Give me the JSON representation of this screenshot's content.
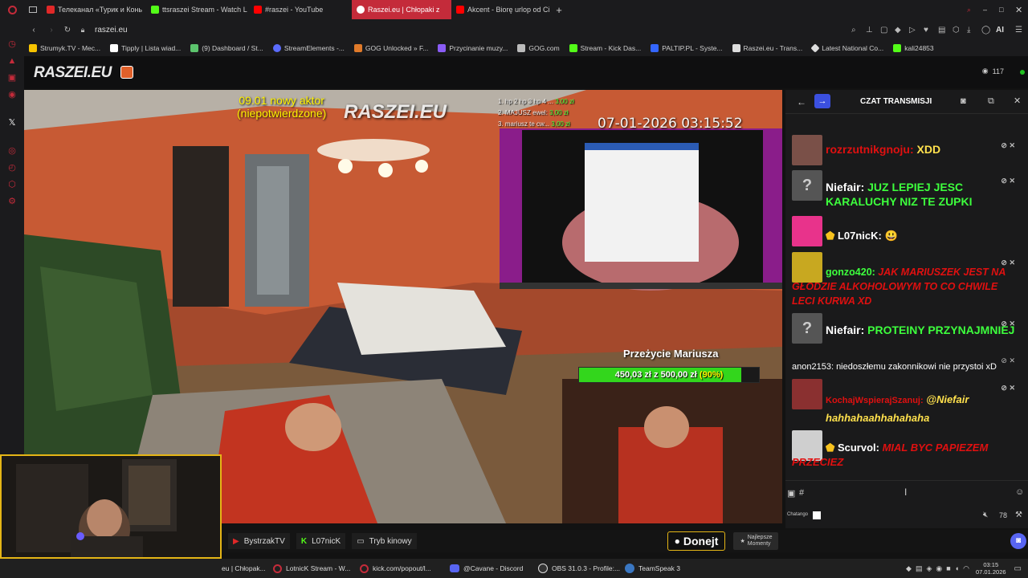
{
  "browser": {
    "tabs": [
      {
        "label": "Телеканал «Турик и Конь",
        "color": "#e02828"
      },
      {
        "label": "ttsraszei Stream - Watch L",
        "color": "#53fc18"
      },
      {
        "label": "#raszei - YouTube",
        "color": "#ff0000"
      },
      {
        "label": "Raszei.eu | Chłopaki z",
        "color": "#ffffff",
        "active": true
      },
      {
        "label": "Akcent - Biorę urlop od Ci",
        "color": "#ff0000"
      }
    ],
    "new_tab": "+",
    "url": "raszei.eu",
    "bookmarks": [
      {
        "label": "Strumyk.TV - Mec...",
        "color": "#f6c300"
      },
      {
        "label": "Tipply | Lista wiad...",
        "color": "#ffffff"
      },
      {
        "label": "(9) Dashboard / St...",
        "color": "#5cc46d"
      },
      {
        "label": "StreamElements -...",
        "color": "#5b6cff"
      },
      {
        "label": "GOG Unlocked » F...",
        "color": "#e07a2a"
      },
      {
        "label": "Przycinanie muzy...",
        "color": "#8a5cf6"
      },
      {
        "label": "GOG.com",
        "color": "#bbbbbb"
      },
      {
        "label": "Stream - Kick Das...",
        "color": "#53fc18"
      },
      {
        "label": "PALTIP.PL - Syste...",
        "color": "#3466ff"
      },
      {
        "label": "Raszei.eu - Trans...",
        "color": "#dddddd"
      },
      {
        "label": "Latest National Co...",
        "color": "#dddddd"
      },
      {
        "label": "kali24853",
        "color": "#53fc18"
      }
    ],
    "ai_label": "AI"
  },
  "site": {
    "logo": "RASZEI.EU",
    "viewer_count": "117"
  },
  "video": {
    "new_actor_line1": "09.01 nowy aktor",
    "new_actor_line2": "(niepotwierdzone)",
    "watermark": "RASZEI.EU",
    "top_list": [
      "1. hp 2 hp 3 hp 4 ...",
      "2. MAJUSZ ewel:",
      "3. mariusz te cw..."
    ],
    "top_amounts": [
      "3,00 zł",
      "3,00 zł",
      "3,00 zł"
    ],
    "timestamp": "07-01-2026 03:15:52",
    "goal_title": "Przeżycie Mariusza",
    "goal_amount": "450,03 zł z 500,00 zł",
    "goal_percent": "(90%)",
    "goal_progress": 0.9
  },
  "chat": {
    "title": "CZAT TRANSMISJI",
    "messages": [
      {
        "user": "rozrzutnikgnoju:",
        "text": "XDD",
        "user_color": "#e01010",
        "text_color": "#ffe14d",
        "avatar": "#7a5048"
      },
      {
        "user": "Niefair:",
        "text": "JUZ LEPIEJ JESC KARALUCHY NIZ TE ZUPKI",
        "user_color": "#ffffff",
        "text_color": "#3dff3d",
        "avatar": "#555555",
        "avatar_text": "?"
      },
      {
        "user": "L07nicK:",
        "text": "😃",
        "user_color": "#ffffff",
        "text_color": "#ffe14d",
        "avatar": "#e8338b",
        "badge": "shield"
      },
      {
        "user": "gonzo420:",
        "text": "JAK MARIUSZEK JEST NA GŁODZIE ALKOHOLOWYM TO CO CHWILE LECI KURWA XD",
        "user_color": "#3dff3d",
        "text_color": "#e01010",
        "avatar": "#c8a820"
      },
      {
        "user": "Niefair:",
        "text": "PROTEINY PRZYNAJMNIEJ",
        "user_color": "#ffffff",
        "text_color": "#3dff3d",
        "avatar": "#555555",
        "avatar_text": "?"
      },
      {
        "user": "anon2153:",
        "text": "niedoszłemu zakonnikowi nie przystoi xD",
        "user_color": "#ffffff",
        "text_color": "#ffffff"
      },
      {
        "user": "KochajWspierajSzanuj:",
        "text": "@Niefair hahhahaahhahahaha",
        "user_color": "#e01010",
        "text_color": "#ffe14d",
        "avatar": "#8a3030"
      },
      {
        "user": "Scurvol:",
        "text": "MIAL BYC PAPIEZEM PRZECIEZ",
        "user_color": "#ffffff",
        "text_color": "#e01010",
        "avatar": "#cfcfcf",
        "badge": "shield"
      }
    ],
    "hash": "#",
    "chatango": "Chatango",
    "volume": "78"
  },
  "footer": {
    "channels": [
      "BystrzakTV",
      "L07nicK",
      "Tryb kinowy"
    ],
    "donate": "Donejt",
    "best_moments_line1": "Najlepsze",
    "best_moments_line2": "Momenty"
  },
  "taskbar": {
    "items": [
      {
        "label": "eu | Chłopak...",
        "color": "#c42b3a"
      },
      {
        "label": "LotnicK Stream - W...",
        "color": "#c42b3a"
      },
      {
        "label": "kick.com/popout/l...",
        "color": "#c42b3a"
      },
      {
        "label": "@Cavane - Discord",
        "color": "#5865f2"
      },
      {
        "label": "OBS 31.0.3 - Profile:...",
        "color": "#dddddd"
      },
      {
        "label": "TeamSpeak 3",
        "color": "#3a77c2"
      }
    ],
    "time": "03:15",
    "date": "07.01.2026"
  }
}
